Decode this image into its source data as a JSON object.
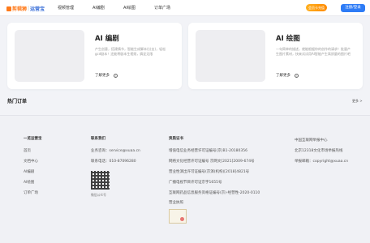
{
  "header": {
    "logo_a": "剪辑狮",
    "logo_sep": "|",
    "logo_b": "运营宝",
    "nav": [
      "视频管理",
      "AI编剧",
      "AI绘图",
      "订单广场"
    ],
    "coupon_label": "会员卡充值",
    "login_label": "注册/登录"
  },
  "cards": [
    {
      "title": "AI 编剧",
      "desc": "产生创意，搭建情节，智能生成脚本(分支)，轻松gcd剧本！还能将剧本生视频，搞定无限",
      "more": "了解更多",
      "more_icon": "arrow-circle-icon"
    },
    {
      "title": "AI 绘图",
      "desc": "一句简单的描述，就能根据你的创作的请求！批量产生图片素材，快来试试用AI智能产生高质量的图片吧",
      "more": "了解更多",
      "more_icon": "arrow-circle-icon"
    }
  ],
  "hot": {
    "title": "热门订单",
    "more": "更多 >"
  },
  "footer": {
    "col1": {
      "title": "一览运营宝",
      "links": [
        "首页",
        "文档中心",
        "AI编剧",
        "AI绘图",
        "订单广场"
      ]
    },
    "col2": {
      "title": "联系我们",
      "lines": [
        "业务咨询：service@xuaa.cn",
        "联系电话：010-87096280"
      ],
      "qr_caption": "微信公众号"
    },
    "col3": {
      "title": "资质证书",
      "lines": [
        "增值电信业务经营许可证编号(京)B1-20180356",
        "网络文化经营许可证编号 京网文[2021]2009-674号",
        "营业性演出许可证编号(京演(机构)[2018]4821号",
        "广播电视节目许可证京字1655号",
        "互联网药品信息服务资格证编号(京)-经营性-2020-0110"
      ],
      "license_label": "营业执照"
    },
    "col4": {
      "lines": [
        "中国互联网举报中心",
        "北京12318文化市场举报热线",
        "举报邮箱：copyright@xuaa.cn"
      ]
    }
  }
}
